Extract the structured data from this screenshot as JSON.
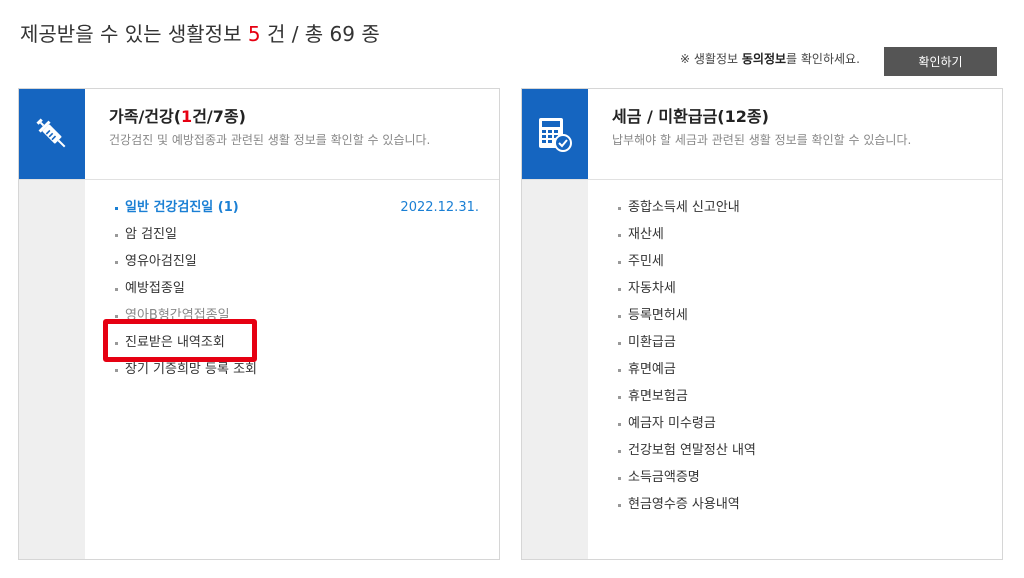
{
  "header": {
    "title_prefix": "제공받을 수 있는 생활정보",
    "count": "5",
    "title_suffix": "건 / 총 69 종"
  },
  "notice": {
    "prefix": "※ 생활정보",
    "bold": "동의정보",
    "suffix": "를 확인하세요."
  },
  "confirm_button": "확인하기",
  "colors": {
    "accent_blue": "#1565c0",
    "link_blue": "#1a7fd4",
    "red": "#e60012"
  },
  "cards": [
    {
      "icon": "syringe-icon",
      "title_prefix": "가족/건강(",
      "title_red": "1",
      "title_suffix": "건/7종)",
      "desc": "건강검진 및 예방접종과 관련된 생활 정보를 확인할 수 있습니다.",
      "items": [
        {
          "label": "일반 건강검진일 (1)",
          "date": "2022.12.31."
        },
        {
          "label": "암 검진일"
        },
        {
          "label": "영유아검진일"
        },
        {
          "label": "예방접종일"
        },
        {
          "label": "영아B형간염접종일"
        },
        {
          "label": "진료받은 내역조회"
        },
        {
          "label": "장기 기증희망 등록 조회"
        }
      ]
    },
    {
      "icon": "calculator-check-icon",
      "title": "세금 / 미환급금(12종)",
      "desc": "납부해야 할 세금과 관련된 생활 정보를 확인할 수 있습니다.",
      "items": [
        "종합소득세 신고안내",
        "재산세",
        "주민세",
        "자동차세",
        "등록면허세",
        "미환급금",
        "휴면예금",
        "휴면보험금",
        "예금자 미수령금",
        "건강보험 연말정산 내역",
        "소득금액증명",
        "현금영수증 사용내역"
      ]
    }
  ]
}
